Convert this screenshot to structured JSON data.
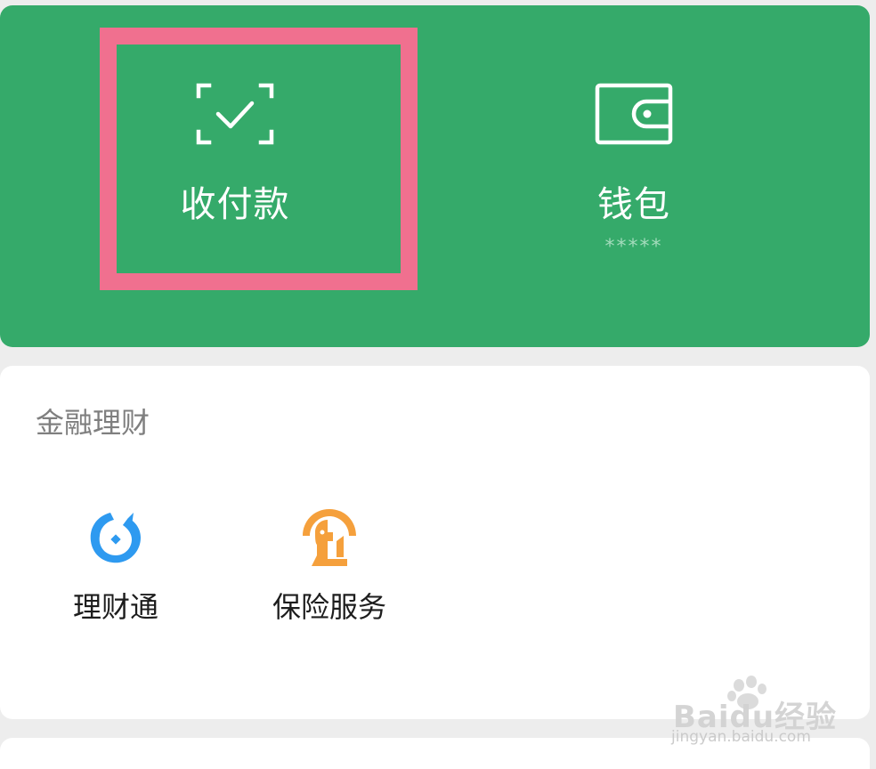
{
  "pay_section": {
    "collect": {
      "label": "收付款",
      "icon": "scan-check-icon"
    },
    "wallet": {
      "label": "钱包",
      "balance": "*****",
      "icon": "wallet-icon"
    },
    "highlight_color": "#f0708f",
    "background_color": "#35aa6a"
  },
  "finance_section": {
    "title": "金融理财",
    "items": [
      {
        "label": "理财通",
        "icon": "licaitong-icon",
        "color": "#2e9af0"
      },
      {
        "label": "保险服务",
        "icon": "insurance-icon",
        "color": "#f5a03c"
      }
    ]
  },
  "watermark": {
    "brand": "Baidu经验",
    "url": "jingyan.baidu.com"
  }
}
